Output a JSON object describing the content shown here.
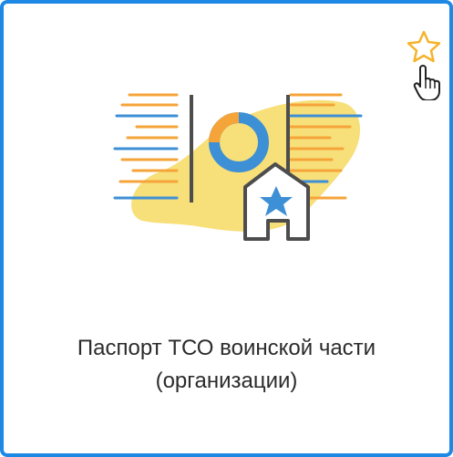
{
  "card": {
    "title_line1": "Паспорт ТСО воинской части",
    "title_line2": "(организации)",
    "illustration_icon": "document-passport-illustration-icon",
    "favorite_icon": "star-outline-icon",
    "cursor_icon": "hand-pointer-icon"
  },
  "colors": {
    "border": "#1e88e5",
    "blue": "#3d8fd6",
    "orange": "#f5a43a",
    "yellow_blob": "#f6dc6a",
    "dark": "#4d4d4d",
    "star": "#f5b32a"
  }
}
